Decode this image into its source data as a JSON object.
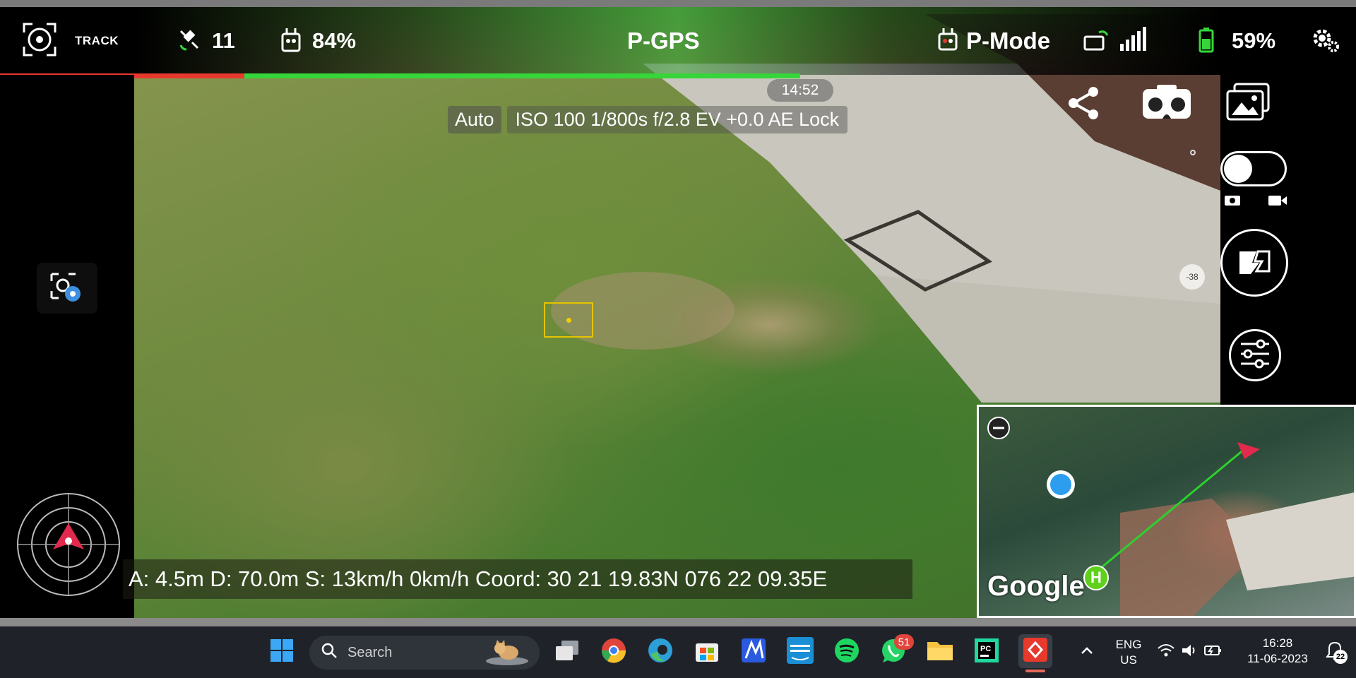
{
  "topbar": {
    "track_label": "TRACK",
    "satellites": "11",
    "controller_battery": "84%",
    "flight_mode": "P-GPS",
    "remote_mode": "P-Mode",
    "drone_battery": "59%"
  },
  "camera": {
    "clock": "14:52",
    "exposure_mode": "Auto",
    "exposure_params": "ISO 100  1/800s  f/2.8  EV +0.0    AE Lock",
    "zoom_indicator": "-38"
  },
  "telemetry": {
    "text": "A: 4.5m D: 70.0m S: 13km/h  0km/h Coord: 30 21 19.83N 076 22 09.35E"
  },
  "minimap": {
    "logo": "Google",
    "home_marker": "H"
  },
  "progress": {
    "red_fraction": 0.18,
    "green_fraction": 0.41
  },
  "taskbar": {
    "search_placeholder": "Search",
    "whatsapp_badge": "51",
    "lang_line1": "ENG",
    "lang_line2": "US",
    "time": "16:28",
    "date": "11-06-2023",
    "notification_count": "22"
  },
  "colors": {
    "accent_green": "#36d63a",
    "accent_red": "#e8382e",
    "focus_yellow": "#e5c400",
    "taskbar_bg": "#1f2329"
  },
  "icons": [
    "track-target-icon",
    "satellite-icon",
    "controller-icon",
    "remote-icon",
    "signal-icon",
    "battery-icon",
    "settings-gear-icon",
    "share-icon",
    "vr-goggles-icon",
    "gallery-icon",
    "photo-video-toggle",
    "shutter-icon",
    "camera-settings-icon",
    "camera-gear-icon",
    "radar-icon",
    "zoom-out-icon",
    "windows-start-icon",
    "search-icon"
  ]
}
